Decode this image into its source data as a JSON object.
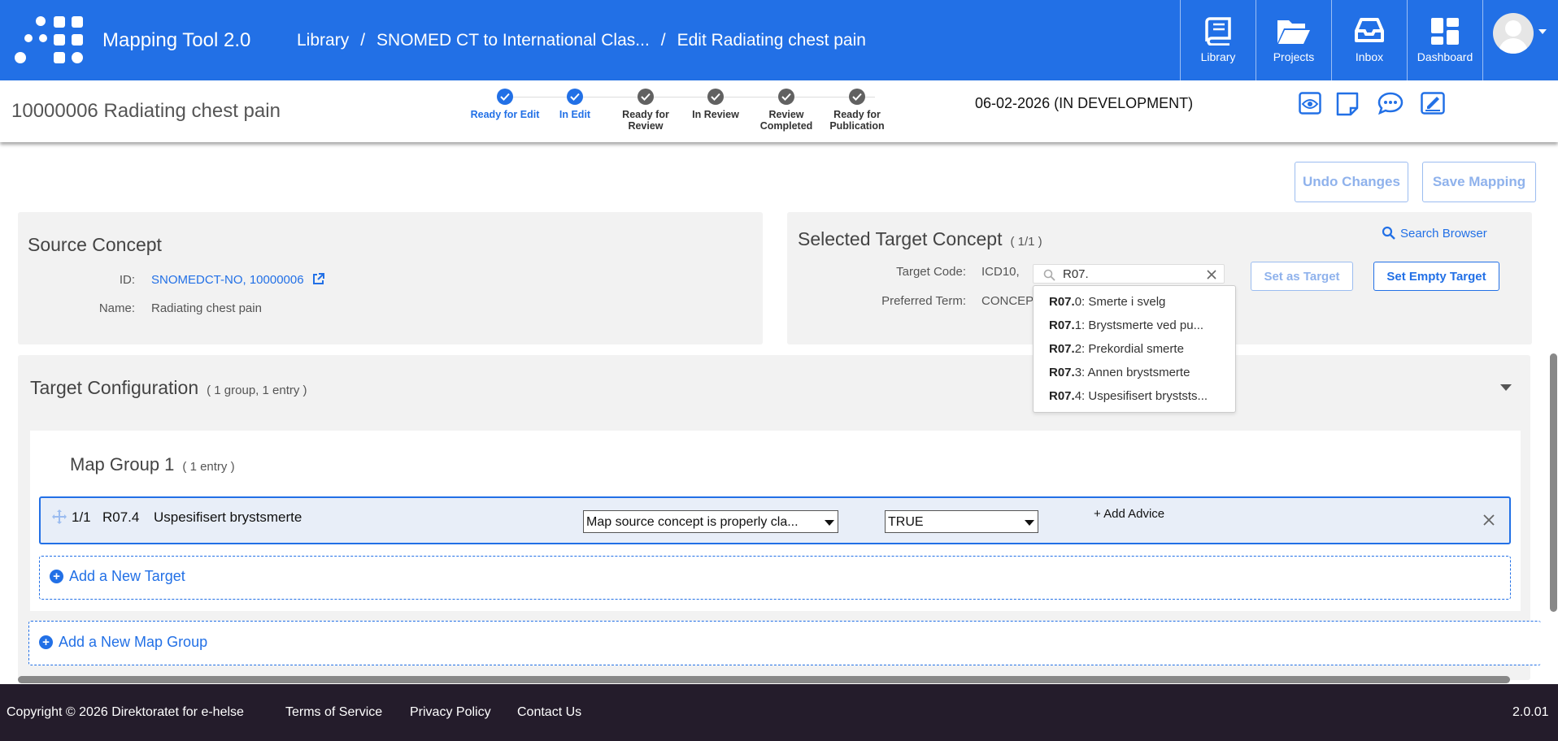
{
  "app": {
    "title": "Mapping Tool 2.0"
  },
  "breadcrumb": [
    {
      "label": "Library"
    },
    {
      "label": "SNOMED CT to International Clas..."
    },
    {
      "label": "Edit Radiating chest pain"
    }
  ],
  "nav": [
    {
      "label": "Library",
      "icon": "book-icon"
    },
    {
      "label": "Projects",
      "icon": "folder-open-icon"
    },
    {
      "label": "Inbox",
      "icon": "inbox-icon"
    },
    {
      "label": "Dashboard",
      "icon": "dashboard-icon"
    }
  ],
  "concept": {
    "title": "10000006 Radiating chest pain"
  },
  "workflow": {
    "steps": [
      {
        "label": "Ready for Edit",
        "state": "done"
      },
      {
        "label": "In Edit",
        "state": "done"
      },
      {
        "label": "Ready for Review",
        "state": "todo"
      },
      {
        "label": "In Review",
        "state": "todo"
      },
      {
        "label": "Review Completed",
        "state": "todo"
      },
      {
        "label": "Ready for Publication",
        "state": "todo"
      }
    ],
    "status": "06-02-2026 (IN DEVELOPMENT)"
  },
  "toolbar": {
    "undo_label": "Undo Changes",
    "save_label": "Save Mapping"
  },
  "source": {
    "title": "Source Concept",
    "id_label": "ID:",
    "id_value": "SNOMEDCT-NO, 10000006",
    "name_label": "Name:",
    "name_value": "Radiating chest pain"
  },
  "target": {
    "title": "Selected Target Concept",
    "count": "( 1/1 )",
    "search_browser_label": "Search Browser",
    "code_label": "Target Code:",
    "code_value": "ICD10,",
    "term_label": "Preferred Term:",
    "term_value": "CONCEPT",
    "search_value": "R07.",
    "set_target_label": "Set as Target",
    "set_empty_label": "Set Empty Target",
    "suggestions": [
      {
        "code": "R07.",
        "suffix": "0",
        "text": ": Smerte i svelg"
      },
      {
        "code": "R07.",
        "suffix": "1",
        "text": ": Brystsmerte ved pu..."
      },
      {
        "code": "R07.",
        "suffix": "2",
        "text": ": Prekordial smerte"
      },
      {
        "code": "R07.",
        "suffix": "3",
        "text": ": Annen brystsmerte"
      },
      {
        "code": "R07.",
        "suffix": "4",
        "text": ": Uspesifisert bryststs..."
      }
    ]
  },
  "config": {
    "title": "Target Configuration",
    "summary": "( 1 group, 1 entry )",
    "group": {
      "title": "Map Group 1",
      "summary": "( 1 entry )",
      "entry": {
        "index": "1/1",
        "code": "R07.4",
        "term": "Uspesifisert brystsmerte",
        "relation": "Map source concept is properly cla...",
        "rule": "TRUE",
        "add_advice_label": "+ Add Advice"
      },
      "add_target_label": "Add a New Target"
    },
    "add_group_label": "Add a New Map Group"
  },
  "footer": {
    "copyright": "Copyright © 2026 Direktoratet for e-helse",
    "terms": "Terms of Service",
    "privacy": "Privacy Policy",
    "contact": "Contact Us",
    "version": "2.0.01"
  },
  "colors": {
    "primary": "#2270e6",
    "footer": "#241c2b",
    "panel": "#f2f2f2"
  }
}
